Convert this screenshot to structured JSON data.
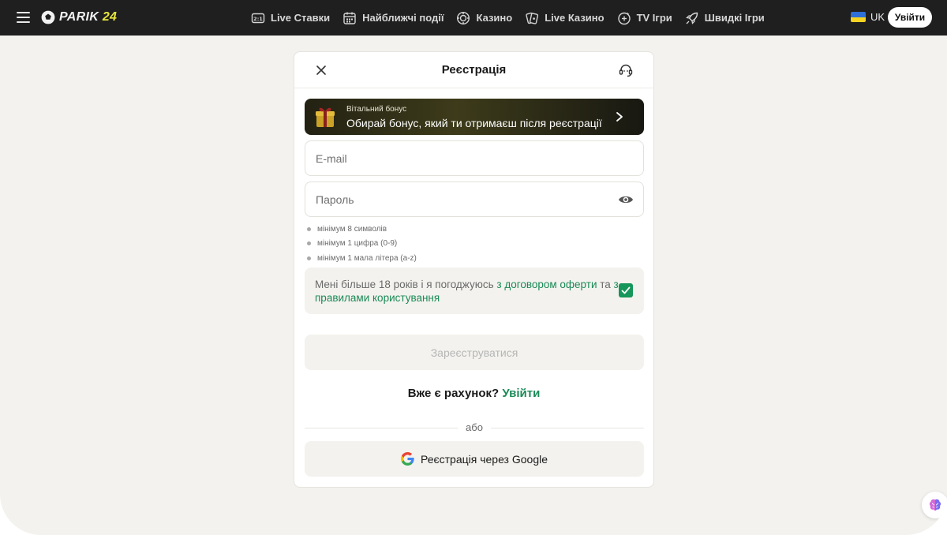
{
  "header": {
    "logo_text": "PARIK",
    "logo_number": "24",
    "nav": [
      {
        "label": "Live Ставки",
        "icon": "live-score-icon"
      },
      {
        "label": "Найближчі події",
        "icon": "calendar-icon"
      },
      {
        "label": "Казино",
        "icon": "casino-chip-icon"
      },
      {
        "label": "Live Казино",
        "icon": "cards-icon"
      },
      {
        "label": "TV Ігри",
        "icon": "tv-games-icon"
      },
      {
        "label": "Швидкі Ігри",
        "icon": "rocket-icon"
      }
    ],
    "language": "UK",
    "login_label": "Увійти"
  },
  "modal": {
    "title": "Реєстрація",
    "bonus": {
      "small_label": "Вітальний бонус",
      "main_label": "Обирай бонус, який ти отримаєш після реєстрації"
    },
    "email": {
      "placeholder": "E-mail",
      "value": ""
    },
    "password": {
      "placeholder": "Пароль",
      "value": ""
    },
    "password_rules": [
      "мінімум 8 символів",
      "мінімум 1 цифра (0-9)",
      "мінімум 1 мала літера (a-z)"
    ],
    "agreement": {
      "text_before": "Мені більше 18 років і я погоджуюсь ",
      "offer_link": "з договором оферти",
      "text_middle": " та ",
      "rules_link": "з правилами користування",
      "checked": true
    },
    "submit_label": "Зареєструватися",
    "have_account_text": "Вже є рахунок? ",
    "have_account_link": "Увійти",
    "or_label": "або",
    "google_label": "Реєстрація через Google"
  },
  "colors": {
    "accent_green": "#1a8a56",
    "checkbox_green": "#16965a",
    "logo_yellow": "#e6e43c",
    "topbar_bg": "#1f1f1f",
    "page_bg": "#f3f2ee"
  }
}
